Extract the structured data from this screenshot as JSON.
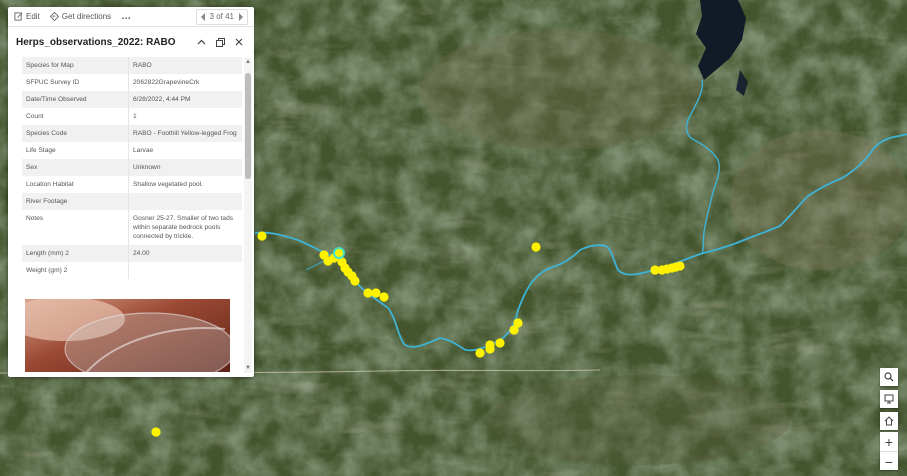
{
  "toolbar": {
    "edit_label": "Edit",
    "directions_label": "Get directions",
    "more_label": "…",
    "pager_label": "3 of 41"
  },
  "popup": {
    "title": "Herps_observations_2022: RABO",
    "fields": [
      {
        "key": "Species for Map",
        "value": "RABO"
      },
      {
        "key": "SFPUC Survey ID",
        "value": "2062822GrapevineCrk"
      },
      {
        "key": "Date/Time Observed",
        "value": "6/28/2022, 4:44 PM"
      },
      {
        "key": "Count",
        "value": "1"
      },
      {
        "key": "Species Code",
        "value": "RABO - Foothill Yellow-legged Frog"
      },
      {
        "key": "Life Stage",
        "value": "Larvae"
      },
      {
        "key": "Sex",
        "value": "Unknown"
      },
      {
        "key": "Location Habitat",
        "value": "Shallow vegetated pool."
      },
      {
        "key": "River Footage",
        "value": ""
      },
      {
        "key": "Notes",
        "value": "Gosner 25-27. Smaller of two tads within separate bedrock pools connected by trickle."
      },
      {
        "key": "Length (mm) 2",
        "value": "24.00"
      },
      {
        "key": "Weight (gm) 2",
        "value": ""
      }
    ]
  },
  "map": {
    "river_color": "#3fb3d6",
    "point_color": "#fff200",
    "selected_color": "#3de0c8"
  },
  "controls": {
    "search_icon": "search-icon",
    "basemap_icon": "monitor-icon",
    "home_icon": "home-icon",
    "zoom_in_label": "+",
    "zoom_out_label": "−"
  }
}
